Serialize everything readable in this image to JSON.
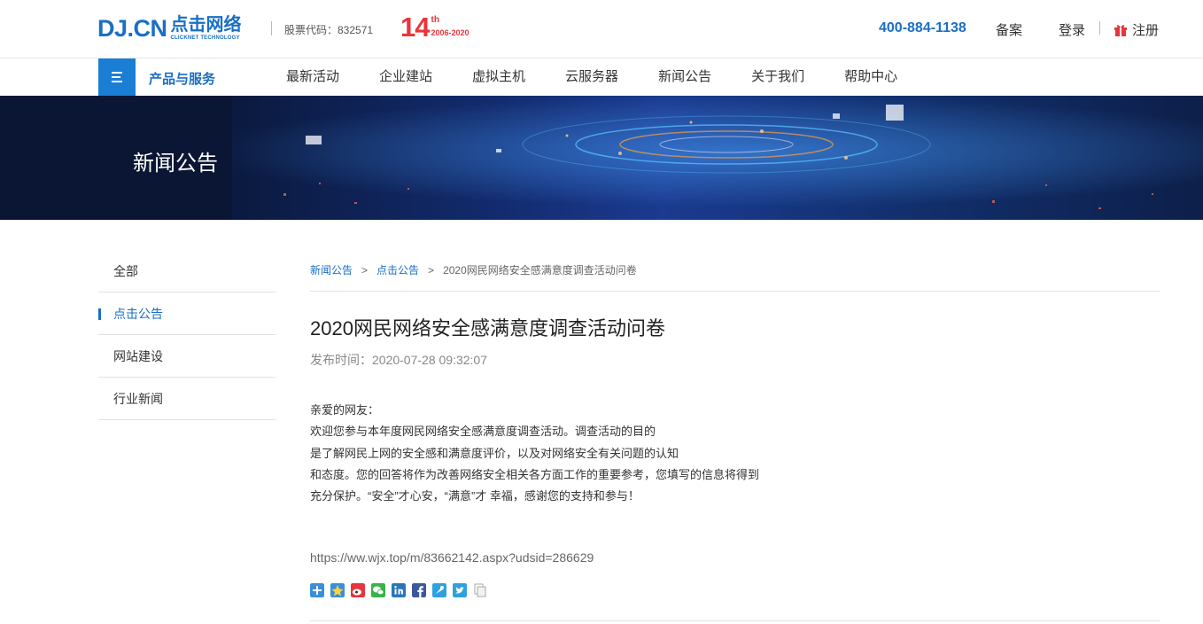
{
  "header": {
    "logo_main": "DJ.CN",
    "logo_cn": "点击网络",
    "logo_sub": "CLICKNET TECHNOLOGY",
    "stock_code": "股票代码：832571",
    "anniv_number": "14",
    "anniv_suffix": "th",
    "anniv_years": "2006-2020",
    "phone": "400-884-1138",
    "record_label": "备案",
    "login_label": "登录",
    "register_label": "注册"
  },
  "nav": {
    "products_label": "产品与服务",
    "items": [
      {
        "label": "最新活动"
      },
      {
        "label": "企业建站"
      },
      {
        "label": "虚拟主机"
      },
      {
        "label": "云服务器"
      },
      {
        "label": "新闻公告"
      },
      {
        "label": "关于我们"
      },
      {
        "label": "帮助中心"
      }
    ]
  },
  "banner": {
    "title": "新闻公告"
  },
  "sidebar": {
    "items": [
      {
        "label": "全部"
      },
      {
        "label": "点击公告"
      },
      {
        "label": "网站建设"
      },
      {
        "label": "行业新闻"
      }
    ]
  },
  "breadcrumb": {
    "level1": "新闻公告",
    "level2": "点击公告",
    "current": "2020网民网络安全感满意度调查活动问卷",
    "separator": ">"
  },
  "article": {
    "title": "2020网民网络安全感满意度调查活动问卷",
    "pubtime": "发布时间：2020-07-28 09:32:07",
    "paragraphs": [
      "亲爱的网友：",
      "欢迎您参与本年度网民网络安全感满意度调查活动。调查活动的目的",
      "是了解网民上网的安全感和满意度评价，以及对网络安全有关问题的认知",
      "和态度。您的回答将作为改善网络安全相关各方面工作的重要参考，您填写的信息将得到",
      "充分保护。“安全”才心安，“满意”才 幸福，感谢您的支持和参与！"
    ],
    "link": "https://ww.wjx.top/m/83662142.aspx?udsid=286629"
  },
  "share": {
    "icons": [
      "share-more-icon",
      "qzone-icon",
      "weibo-icon",
      "wechat-icon",
      "linkedin-icon",
      "facebook-icon",
      "tencent-weibo-icon",
      "twitter-icon",
      "copy-icon"
    ]
  },
  "colors": {
    "brand": "#1a6fc4",
    "accent_red": "#e8353c",
    "nav_button": "#1a7fd4"
  }
}
